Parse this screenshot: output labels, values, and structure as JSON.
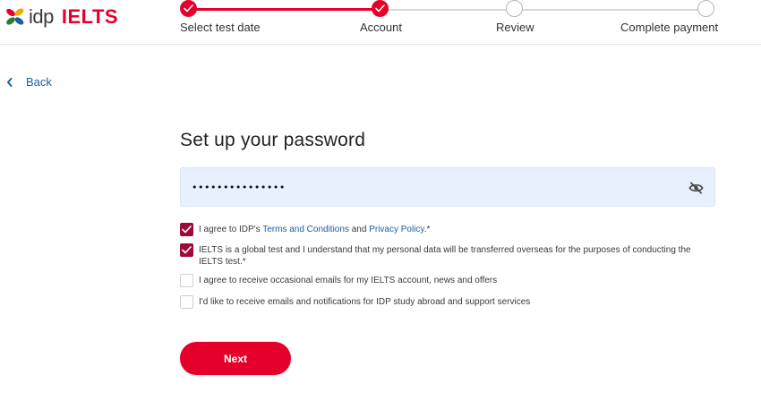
{
  "brand": {
    "logo_text": "idp",
    "product": "IELTS",
    "color": "#e4002b"
  },
  "stepper": {
    "steps": [
      {
        "label": "Select test date",
        "status": "done"
      },
      {
        "label": "Account",
        "status": "done"
      },
      {
        "label": "Review",
        "status": "todo"
      },
      {
        "label": "Complete payment",
        "status": "todo"
      }
    ]
  },
  "nav": {
    "back_label": "Back"
  },
  "form": {
    "title": "Set up your password",
    "password_value": "•••••••••••••••",
    "password_visibility_icon": "eye-slash-icon",
    "checkboxes": [
      {
        "checked": true,
        "prefix": "I agree to IDP's ",
        "link1": "Terms and Conditions",
        "mid": " and ",
        "link2": "Privacy Policy",
        "suffix": ".*"
      },
      {
        "checked": true,
        "text": "IELTS is a global test and I understand that my personal data will be transferred overseas for the purposes of conducting the IELTS test.*"
      },
      {
        "checked": false,
        "text": "I agree to receive occasional emails for my IELTS account, news and offers"
      },
      {
        "checked": false,
        "text": "I'd like to receive emails and notifications for IDP study abroad and support services"
      }
    ],
    "next_label": "Next"
  }
}
